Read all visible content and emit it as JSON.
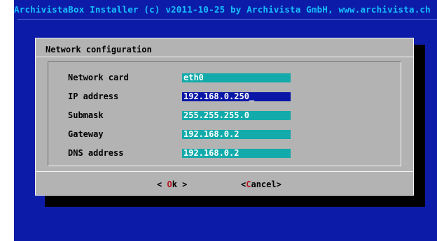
{
  "header": {
    "title": "ArchivistaBox Installer (c) v2011-10-25 by Archivista GmbH, www.archivista.ch"
  },
  "dialog": {
    "title": "Network configuration",
    "fields": [
      {
        "label": "Network card",
        "value": "eth0"
      },
      {
        "label": "IP address",
        "value": "192.168.0.250_"
      },
      {
        "label": "Submask",
        "value": "255.255.255.0"
      },
      {
        "label": "Gateway",
        "value": "192.168.0.2"
      },
      {
        "label": "DNS address",
        "value": "192.168.0.2"
      }
    ],
    "buttons": {
      "ok": {
        "left": "< ",
        "hot": "O",
        "rest": "k",
        "right": " >"
      },
      "cancel": {
        "left": "<",
        "hot": "C",
        "rest": "ancel",
        "right": ">"
      }
    }
  },
  "colors": {
    "screen_bg": "#0c1ca8",
    "dialog_bg": "#b3b3b3",
    "input_bg": "#12aaaa",
    "input_active_bg": "#0a16a6",
    "hotkey": "#b4161f"
  }
}
